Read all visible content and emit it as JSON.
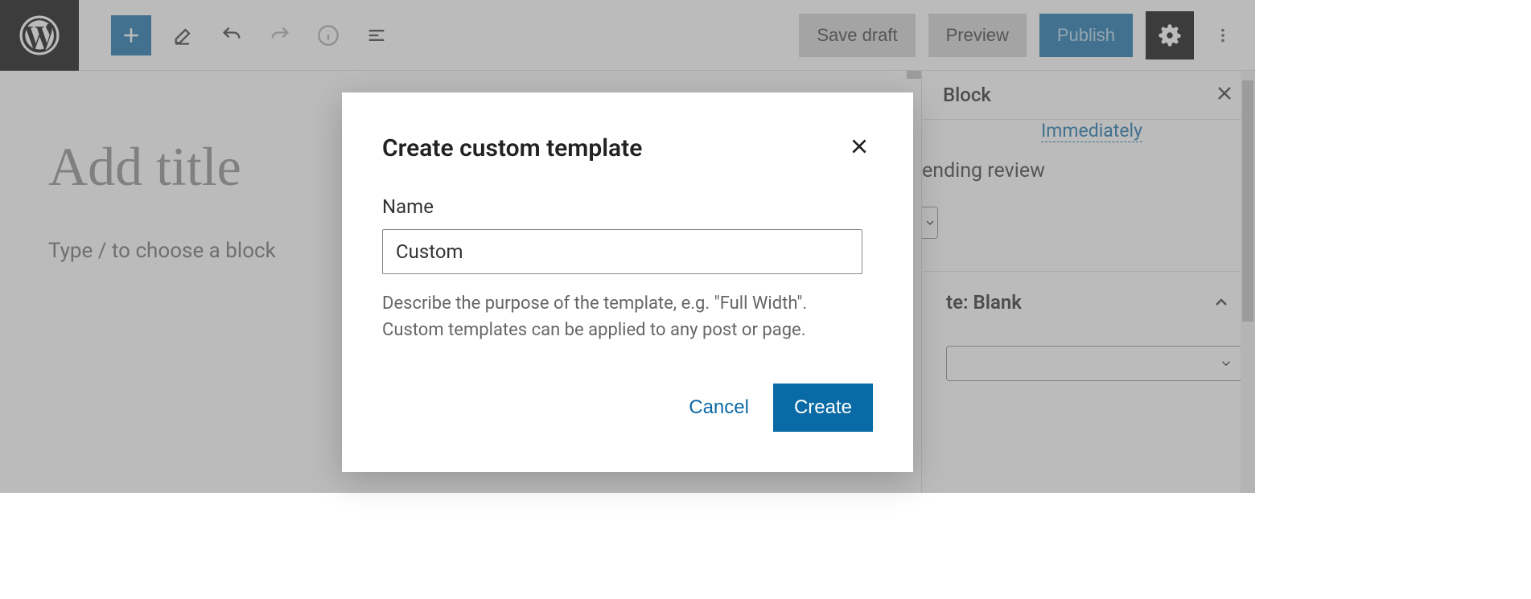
{
  "toolbar": {
    "save_draft": "Save draft",
    "preview": "Preview",
    "publish": "Publish"
  },
  "editor": {
    "title_placeholder": "Add title",
    "block_prompt": "Type / to choose a block"
  },
  "sidebar": {
    "tab_label": "Block",
    "immediately": "Immediately",
    "pending_review": "ending review",
    "template_label": "te: Blank"
  },
  "modal": {
    "title": "Create custom template",
    "name_label": "Name",
    "name_value": "Custom",
    "description": "Describe the purpose of the template, e.g. \"Full Width\". Custom templates can be applied to any post or page.",
    "cancel": "Cancel",
    "create": "Create"
  }
}
